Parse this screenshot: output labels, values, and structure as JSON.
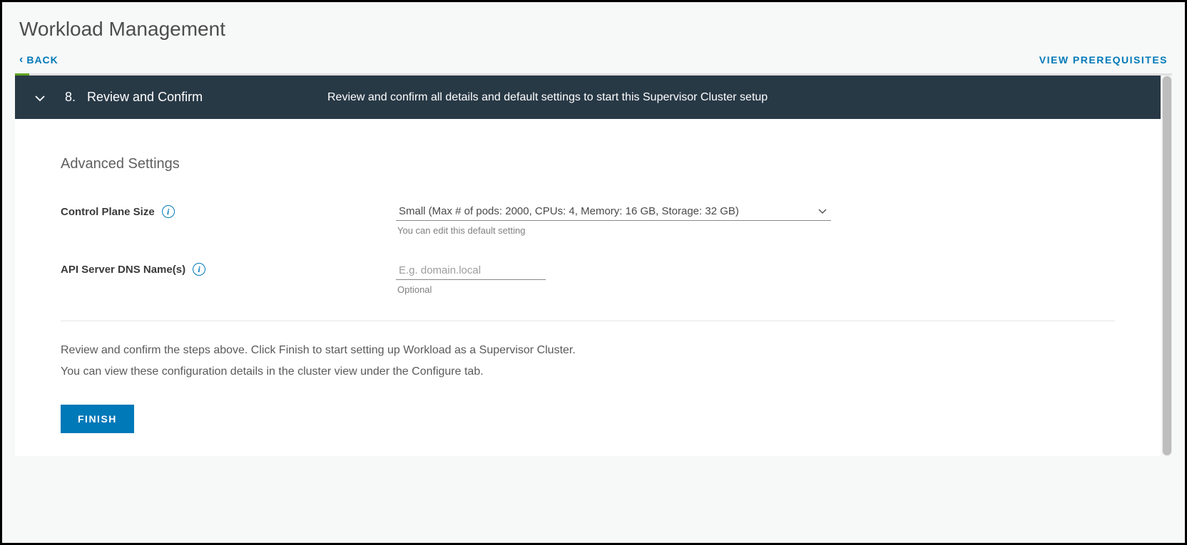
{
  "page": {
    "title": "Workload Management"
  },
  "topbar": {
    "back_label": "BACK",
    "view_prereq_label": "VIEW PREREQUISITES"
  },
  "step": {
    "number": "8.",
    "title": "Review and Confirm",
    "description": "Review and confirm all details and default settings to start this Supervisor Cluster setup"
  },
  "advanced": {
    "section_title": "Advanced Settings",
    "control_plane": {
      "label": "Control Plane Size",
      "selected": "Small (Max # of pods: 2000, CPUs: 4, Memory: 16 GB, Storage: 32 GB)",
      "helper": "You can edit this default setting"
    },
    "api_dns": {
      "label": "API Server DNS Name(s)",
      "placeholder": "E.g. domain.local",
      "value": "",
      "helper": "Optional"
    }
  },
  "review": {
    "line1": "Review and confirm the steps above. Click Finish to start setting up Workload as a Supervisor Cluster.",
    "line2": "You can view these configuration details in the cluster view under the Configure tab."
  },
  "actions": {
    "finish_label": "FINISH"
  }
}
